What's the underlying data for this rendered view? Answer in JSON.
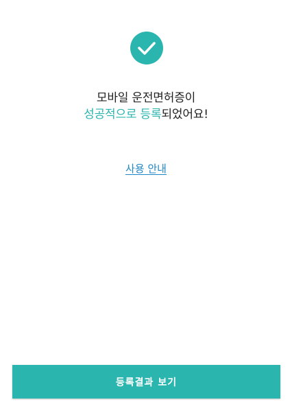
{
  "colors": {
    "accent": "#2ab5ae",
    "link": "#1f86c7",
    "text": "#222222"
  },
  "status_icon": "check-circle-icon",
  "message": {
    "line1": "모바일 운전면허증이",
    "line2_accent": "성공적으로 등록",
    "line2_rest": "되었어요!"
  },
  "guide_link_label": "사용 안내",
  "result_button_label": "등록결과 보기"
}
